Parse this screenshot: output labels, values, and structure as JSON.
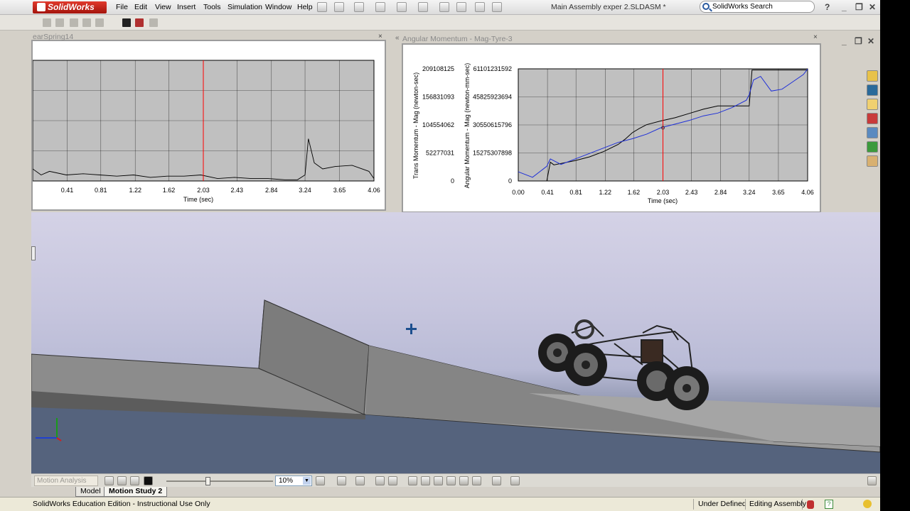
{
  "app": {
    "logo_text": "SolidWorks",
    "document_title": "Main Assembly exper 2.SLDASM *",
    "search_placeholder": "SolidWorks Search"
  },
  "menu": [
    "File",
    "Edit",
    "View",
    "Insert",
    "Tools",
    "Simulation",
    "Window",
    "Help"
  ],
  "plot_left": {
    "title": "earSpring14",
    "x_label": "Time (sec)",
    "x_ticks": [
      "0.41",
      "0.81",
      "1.22",
      "1.62",
      "2.03",
      "2.43",
      "2.84",
      "3.24",
      "3.65",
      "4.06"
    ]
  },
  "plot_right": {
    "title": "Angular Momentum - Mag-Tyre-3",
    "x_label": "Time (sec)",
    "y1_label": "Trans Momentum - Mag (newton-sec)",
    "y2_label": "Angular Momentum - Mag (newton-mm-sec)",
    "y1_ticks": [
      "209108125",
      "156831093",
      "104554062",
      "52277031",
      "0"
    ],
    "y2_ticks": [
      "61101231592",
      "45825923694",
      "30550615796",
      "15275307898",
      "0"
    ],
    "x_ticks": [
      "0.00",
      "0.41",
      "0.81",
      "1.22",
      "1.62",
      "2.03",
      "2.43",
      "2.84",
      "3.24",
      "3.65",
      "4.06"
    ]
  },
  "chart_data": [
    {
      "type": "line",
      "title": "earSpring14",
      "xlabel": "Time (sec)",
      "xlim": [
        0,
        4.06
      ],
      "grid": true,
      "marker_time": 2.03,
      "series": [
        {
          "x": [
            0.0,
            0.1,
            0.2,
            0.4,
            0.6,
            0.8,
            1.0,
            1.2,
            1.4,
            1.6,
            1.8,
            2.0,
            2.2,
            2.4,
            2.6,
            2.8,
            3.0,
            3.15,
            3.24,
            3.28,
            3.35,
            3.45,
            3.6,
            3.8,
            4.0,
            4.06
          ],
          "values": [
            0.1,
            0.05,
            0.08,
            0.05,
            0.06,
            0.05,
            0.04,
            0.05,
            0.03,
            0.04,
            0.04,
            0.05,
            0.02,
            0.03,
            0.02,
            0.02,
            0.01,
            0.01,
            0.05,
            0.35,
            0.15,
            0.1,
            0.12,
            0.13,
            0.08,
            0.02
          ]
        }
      ]
    },
    {
      "type": "line",
      "title": "Angular Momentum - Mag-Tyre-3",
      "xlabel": "Time (sec)",
      "ylabel": "Trans Momentum - Mag (newton-sec)",
      "y2label": "Angular Momentum - Mag (newton-mm-sec)",
      "xlim": [
        0,
        4.06
      ],
      "ylim": [
        0,
        209108125
      ],
      "y2lim": [
        0,
        61101231592
      ],
      "grid": true,
      "marker_time": 2.03,
      "series": [
        {
          "color": "#000000",
          "axis": "y1",
          "x": [
            0.0,
            0.2,
            0.4,
            0.45,
            0.5,
            0.8,
            1.0,
            1.2,
            1.4,
            1.5,
            1.6,
            1.7,
            1.8,
            2.0,
            2.2,
            2.4,
            2.6,
            2.8,
            3.0,
            3.2,
            3.24,
            3.28,
            3.5,
            3.8,
            4.0,
            4.06
          ],
          "values": [
            0,
            0,
            0,
            35000000,
            30000000,
            38000000,
            45000000,
            55000000,
            68000000,
            78000000,
            90000000,
            98000000,
            105000000,
            112000000,
            118000000,
            126000000,
            134000000,
            140000000,
            140000000,
            140000000,
            140000000,
            207000000,
            207000000,
            207000000,
            207000000,
            207000000
          ]
        },
        {
          "color": "#1e2fd8",
          "axis": "y2",
          "x": [
            0.0,
            0.2,
            0.4,
            0.45,
            0.6,
            0.8,
            1.0,
            1.2,
            1.4,
            1.6,
            1.8,
            2.0,
            2.2,
            2.4,
            2.6,
            2.8,
            3.0,
            3.2,
            3.24,
            3.3,
            3.4,
            3.55,
            3.7,
            3.85,
            4.0,
            4.06
          ],
          "values": [
            5000000000,
            2000000000,
            8000000000,
            12000000000,
            9000000000,
            12000000000,
            15000000000,
            18000000000,
            21000000000,
            23000000000,
            25500000000,
            29000000000,
            31000000000,
            33000000000,
            35500000000,
            37000000000,
            40000000000,
            44000000000,
            47000000000,
            55000000000,
            57000000000,
            49000000000,
            50000000000,
            54000000000,
            58000000000,
            61000000000
          ]
        }
      ]
    }
  ],
  "motion_bar": {
    "study_type": "Motion Analysis",
    "zoom_value": "10%"
  },
  "tabs": [
    "Model",
    "Motion Study 2"
  ],
  "status": {
    "edition": "SolidWorks Education Edition - Instructional Use Only",
    "definition": "Under Defined",
    "mode": "Editing Assembly"
  }
}
